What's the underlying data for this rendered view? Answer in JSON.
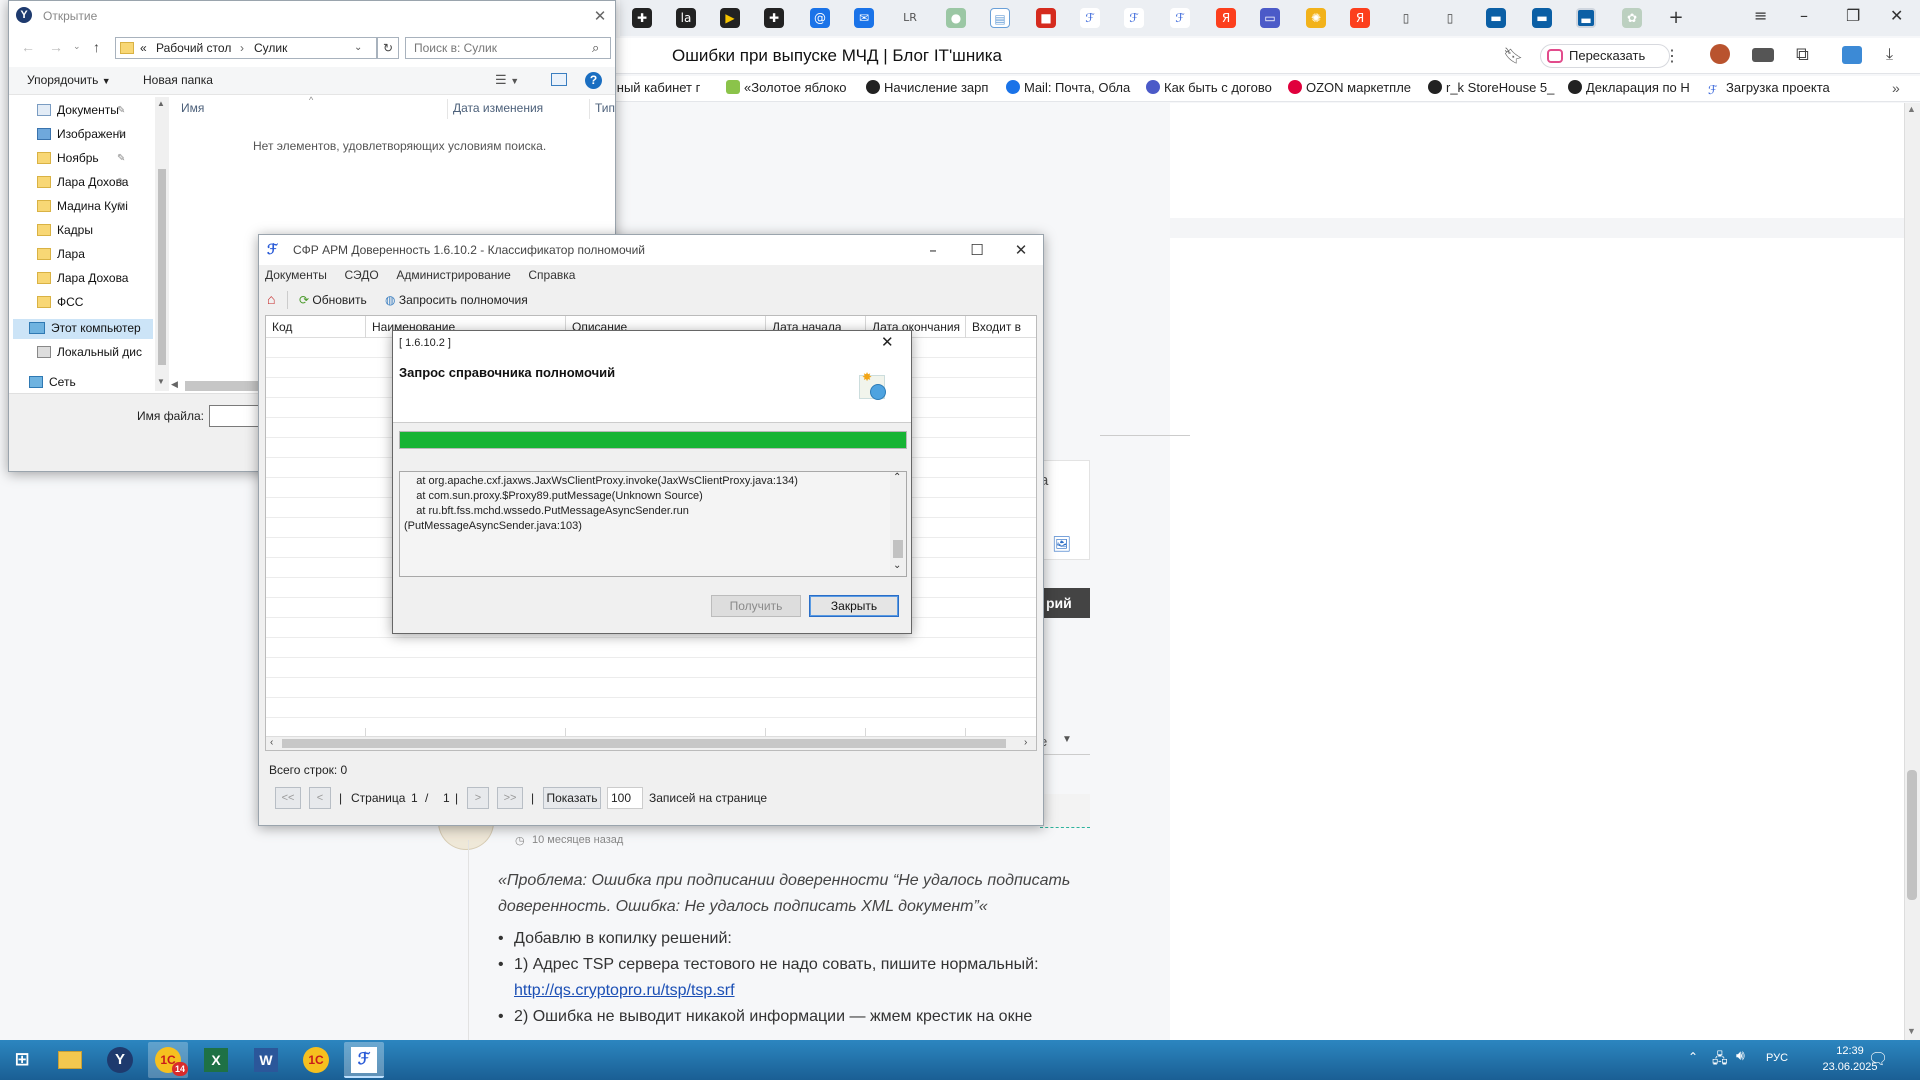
{
  "browser": {
    "page_title": "Ошибки при выпуске МЧД | Блог IT'шника",
    "retell_label": "Пересказать",
    "tab_labels": [
      "LR"
    ],
    "bookmarks": [
      "чный кабинет г",
      "«Золотое яблоко",
      "Начисление зарп",
      "Mail: Почта, Обла",
      "Как быть с догово",
      "OZON маркетпле",
      "r_k StoreHouse 5_",
      "Декларация по Н",
      "Загрузка проекта"
    ]
  },
  "page": {
    "fragment_1": "а",
    "fragment_2": "рий",
    "fragment_3": "е",
    "time_ago": "10 месяцев назад",
    "quote": "«Проблема: Ошибка при подписании доверенности “Не удалось подписать доверенность. Ошибка: Не удалось подписать XML документ”«",
    "bullets": [
      "Добавлю в копилку решений:",
      "1) Адрес TSP сервера тестового не надо совать, пишите нормальный:",
      "2) Ошибка не выводит никакой информации — жмем крестик на окне"
    ],
    "link": "http://qs.cryptopro.ru/tsp/tsp.srf"
  },
  "file_dialog": {
    "title": "Открытие",
    "path": [
      "«",
      "Рабочий стол",
      "›",
      "Сулик"
    ],
    "search_placeholder": "Поиск в: Сулик",
    "organize": "Упорядочить",
    "new_folder": "Новая папка",
    "columns": [
      "Имя",
      "Дата изменения",
      "Тип"
    ],
    "empty_message": "Нет элементов, удовлетворяющих условиям поиска.",
    "tree": [
      "Документы",
      "Изображени",
      "Ноябрь",
      "Лара Дохова",
      "Мадина Кумі",
      "Кадры",
      "Лара",
      "Лара Дохова",
      "ФСС",
      "Этот компьютер",
      "Локальный дис",
      "Сеть"
    ],
    "filename_label": "Имя файла:"
  },
  "app": {
    "title": "СФР АРМ Доверенность 1.6.10.2 - Классификатор полномочий",
    "menu": [
      "Документы",
      "СЭДО",
      "Администрирование",
      "Справка"
    ],
    "toolbar": {
      "refresh": "Обновить",
      "request": "Запросить полномочия"
    },
    "columns": [
      "Код",
      "Наименование",
      "Описание",
      "Дата начала",
      "Дата окончания",
      "Входит в"
    ],
    "total_rows": "Всего строк: 0",
    "pager": {
      "first": "<<",
      "prev": "<",
      "sep1": "|",
      "page_label": "Страница",
      "page": "1",
      "slash": "/",
      "pages": "1",
      "sep2": "|",
      "next": ">",
      "last": ">>",
      "sep3": "|",
      "show": "Показать",
      "per_page": "100",
      "per_page_label": "Записей на странице"
    }
  },
  "dialog": {
    "version": "[ 1.6.10.2 ]",
    "heading": "Запрос справочника полномочий",
    "progress": 1.0,
    "log_lines": [
      "    at org.apache.cxf.jaxws.JaxWsClientProxy.invoke(JaxWsClientProxy.java:134)",
      "    at com.sun.proxy.$Proxy89.putMessage(Unknown Source)",
      "    at ru.bft.fss.mchd.wssedo.PutMessageAsyncSender.run",
      "(PutMessageAsyncSender.java:103)"
    ],
    "get_button": "Получить",
    "close_button": "Закрыть"
  },
  "taskbar": {
    "badge": "14",
    "lang": "РУС",
    "time": "12:39",
    "date": "23.06.2025"
  },
  "colors": {
    "progress": "#17b434",
    "accent": "#1a73e8",
    "taskbar": "#1f6fa6"
  }
}
